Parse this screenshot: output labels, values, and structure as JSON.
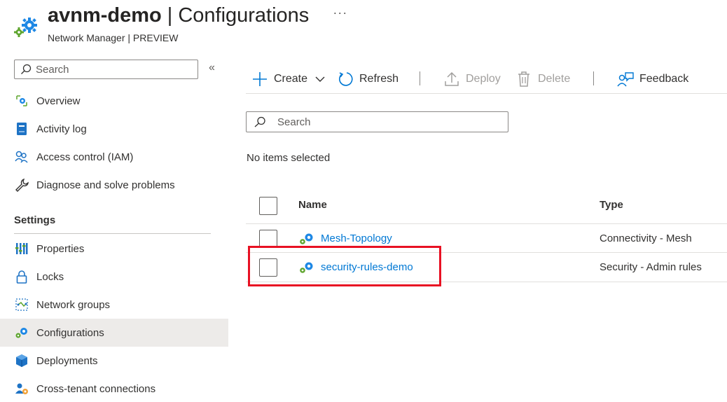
{
  "header": {
    "resource_name": "avnm-demo",
    "separator": "|",
    "page_name": "Configurations",
    "more": "···",
    "subtitle": "Network Manager | PREVIEW"
  },
  "sidebar": {
    "search_placeholder": "Search",
    "collapse": "«",
    "items": [
      {
        "label": "Overview",
        "icon": "overview-gear-icon"
      },
      {
        "label": "Activity log",
        "icon": "activity-log-icon"
      },
      {
        "label": "Access control (IAM)",
        "icon": "people-icon"
      },
      {
        "label": "Diagnose and solve problems",
        "icon": "wrench-icon"
      }
    ],
    "settings_label": "Settings",
    "settings_items": [
      {
        "label": "Properties",
        "icon": "properties-bars-icon"
      },
      {
        "label": "Locks",
        "icon": "lock-icon"
      },
      {
        "label": "Network groups",
        "icon": "network-groups-icon"
      },
      {
        "label": "Configurations",
        "icon": "configurations-gear-icon",
        "active": true
      },
      {
        "label": "Deployments",
        "icon": "cube-icon"
      },
      {
        "label": "Cross-tenant connections",
        "icon": "cross-tenant-icon"
      }
    ]
  },
  "toolbar": {
    "create": "Create",
    "refresh": "Refresh",
    "deploy": "Deploy",
    "delete": "Delete",
    "feedback": "Feedback"
  },
  "main": {
    "search_placeholder": "Search",
    "status": "No items selected",
    "columns": {
      "name": "Name",
      "type": "Type"
    },
    "rows": [
      {
        "name": "Mesh-Topology",
        "type": "Connectivity - Mesh"
      },
      {
        "name": "security-rules-demo",
        "type": "Security - Admin rules"
      }
    ]
  },
  "colors": {
    "accent": "#0078d4",
    "highlight": "#e81123",
    "active_nav": "#edebe9"
  }
}
